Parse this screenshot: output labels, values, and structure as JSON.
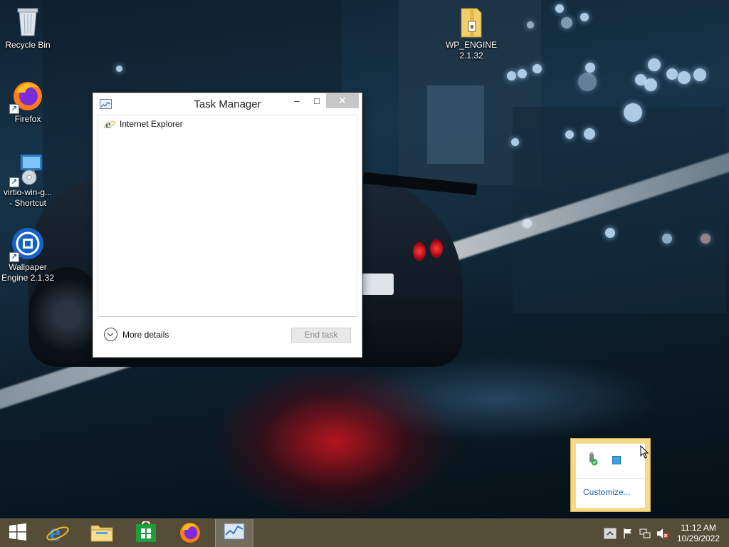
{
  "desktop": {
    "icons": [
      {
        "label": "Recycle Bin",
        "icon": "recycle-bin-icon"
      },
      {
        "label": "Firefox",
        "icon": "firefox-icon"
      },
      {
        "label": "virtio-win-g... - Shortcut",
        "line1": "virtio-win-g...",
        "line2": "- Shortcut",
        "icon": "installer-shortcut-icon"
      },
      {
        "label": "Wallpaper Engine 2.1.32",
        "line1": "Wallpaper",
        "line2": "Engine 2.1.32",
        "icon": "wallpaper-engine-icon"
      },
      {
        "label": "WP_ENGINE 2.1.32",
        "line1": "WP_ENGINE",
        "line2": "2.1.32",
        "icon": "zip-folder-icon"
      }
    ]
  },
  "task_manager": {
    "title": "Task Manager",
    "controls": {
      "minimize": "–",
      "maximize": "□",
      "close": "✕"
    },
    "apps": [
      {
        "name": "Internet Explorer",
        "icon": "internet-explorer-icon"
      }
    ],
    "more_details_label": "More details",
    "end_task_label": "End task"
  },
  "tray_popup": {
    "customize_label": "Customize...",
    "icons": [
      "usb-safe-remove-icon",
      "blue-square-icon"
    ]
  },
  "taskbar": {
    "pinned": [
      {
        "name": "start",
        "icon": "windows-start-icon"
      },
      {
        "name": "internet-explorer",
        "icon": "internet-explorer-icon"
      },
      {
        "name": "file-explorer",
        "icon": "file-explorer-icon"
      },
      {
        "name": "store",
        "icon": "store-icon"
      },
      {
        "name": "firefox",
        "icon": "firefox-icon"
      },
      {
        "name": "task-manager",
        "icon": "task-manager-icon",
        "active": true
      }
    ],
    "tray": {
      "icons": [
        "show-hidden-icons-chevron",
        "action-center-flag-icon",
        "network-icon",
        "volume-muted-icon"
      ],
      "time": "11:12 AM",
      "date": "10/29/2022"
    }
  },
  "colors": {
    "taskbar": "#5c523a",
    "popup_border": "#f3d98a",
    "link": "#1d5fb4",
    "close_button": "#c7c7c7"
  }
}
